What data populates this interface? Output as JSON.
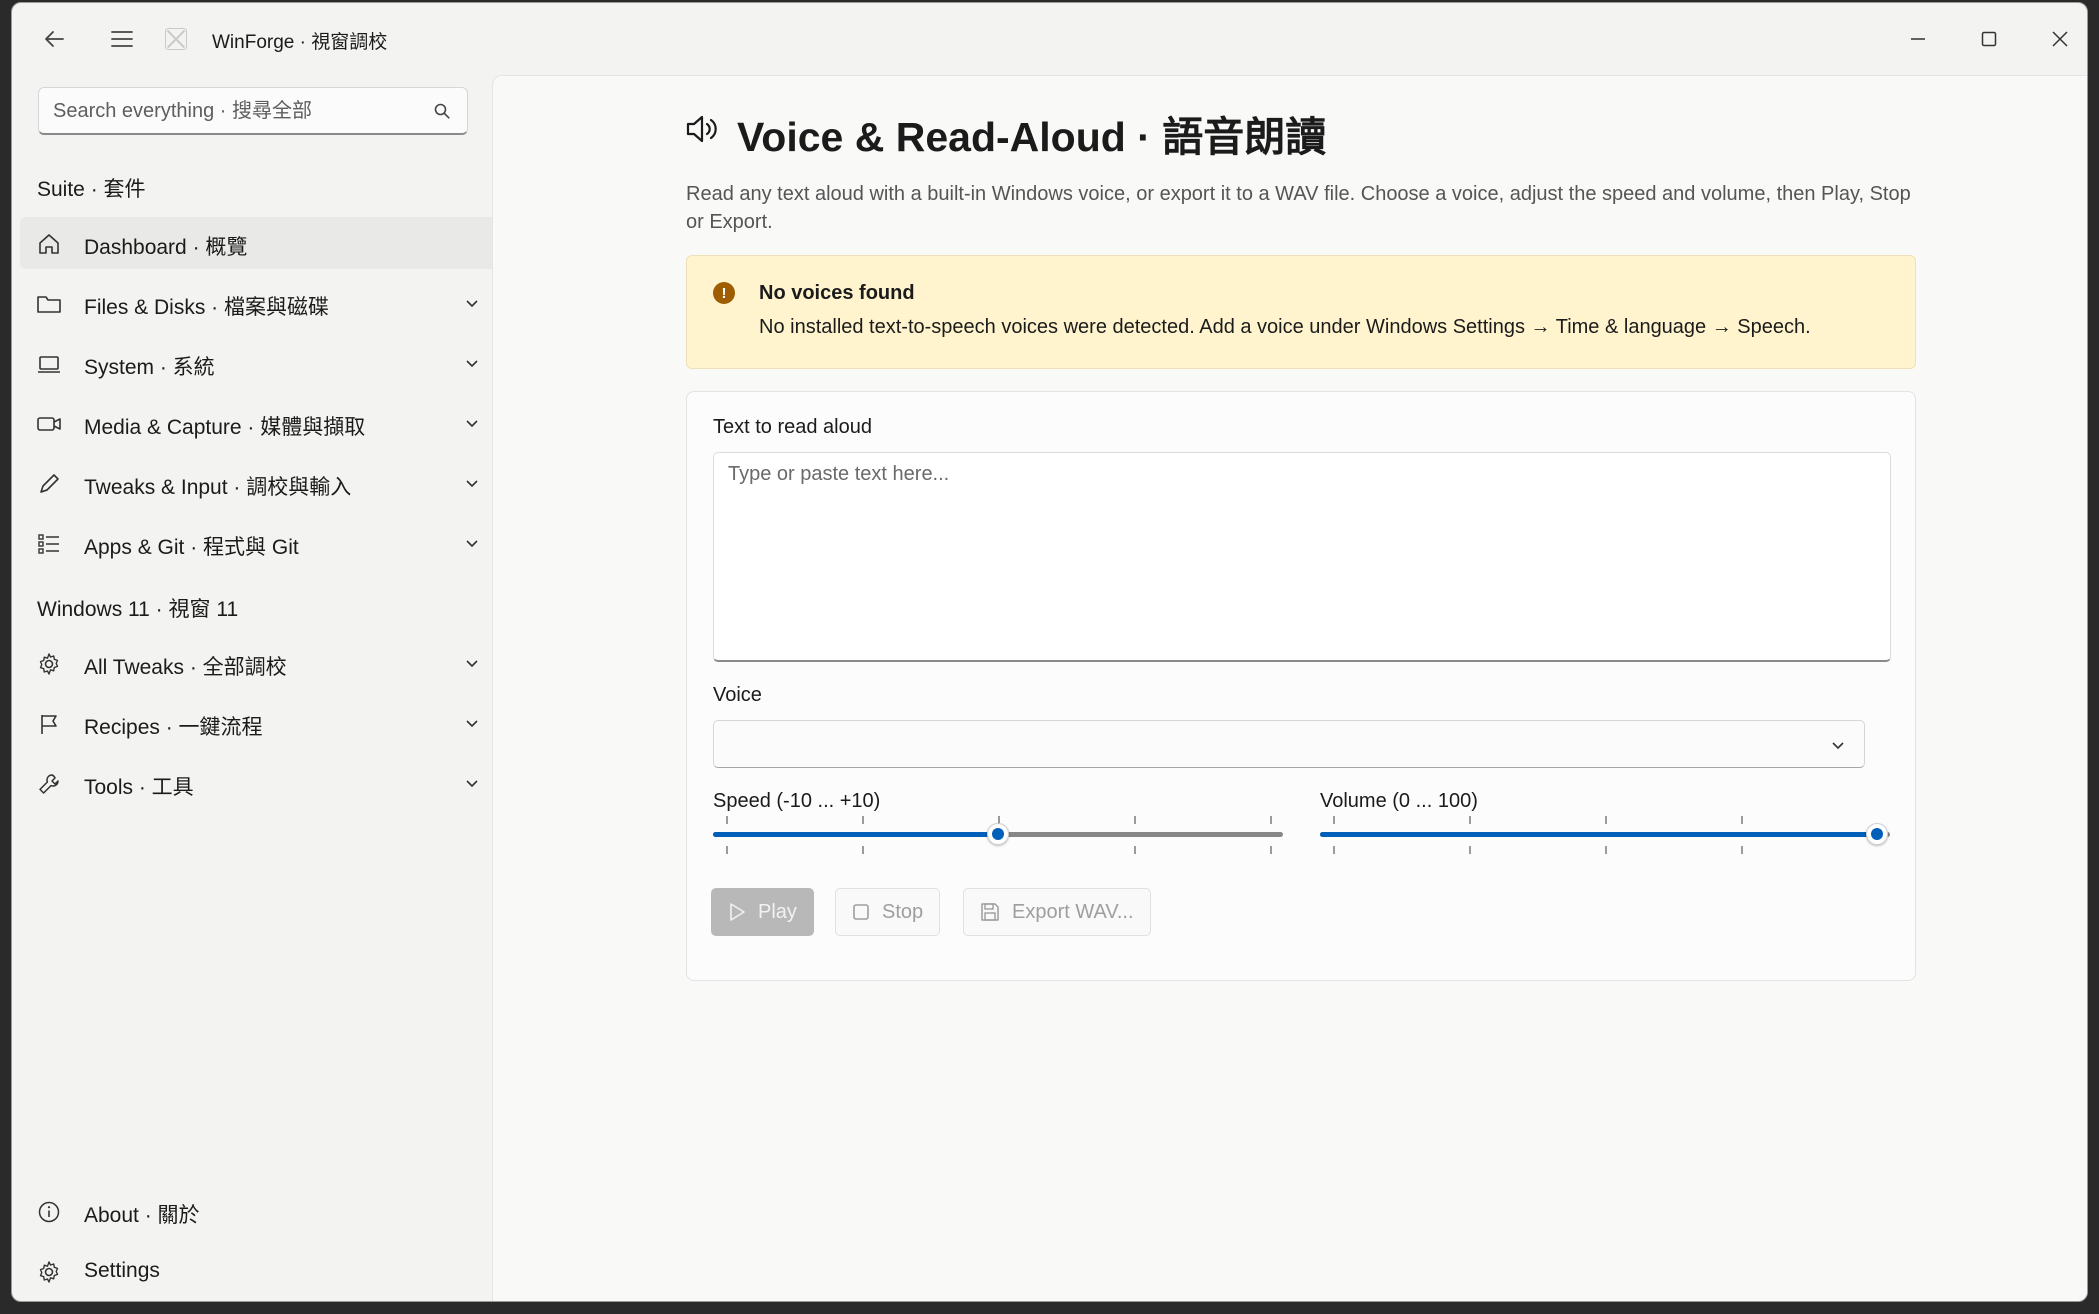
{
  "window": {
    "title": "WinForge · 視窗調校"
  },
  "sidebar": {
    "search_placeholder": "Search everything · 搜尋全部",
    "groups": [
      {
        "header": "Suite · 套件"
      },
      {
        "header": "Windows 11 · 視窗 11"
      }
    ],
    "items": [
      {
        "label": "Dashboard · 概覽",
        "icon": "home-icon",
        "selected": true,
        "expandable": false
      },
      {
        "label": "Files & Disks · 檔案與磁碟",
        "icon": "folder-icon",
        "expandable": true
      },
      {
        "label": "System · 系統",
        "icon": "laptop-icon",
        "expandable": true
      },
      {
        "label": "Media & Capture · 媒體與擷取",
        "icon": "video-camera-icon",
        "expandable": true
      },
      {
        "label": "Tweaks & Input · 調校與輸入",
        "icon": "pen-icon",
        "expandable": true
      },
      {
        "label": "Apps & Git · 程式與 Git",
        "icon": "list-icon",
        "expandable": true
      },
      {
        "label": "All Tweaks · 全部調校",
        "icon": "gear-icon",
        "expandable": true
      },
      {
        "label": "Recipes · 一鍵流程",
        "icon": "flag-icon",
        "expandable": true
      },
      {
        "label": "Tools · 工具",
        "icon": "wrench-icon",
        "expandable": true
      }
    ],
    "footer": [
      {
        "label": "About · 關於",
        "icon": "info-icon"
      },
      {
        "label": "Settings",
        "icon": "gear-icon"
      }
    ]
  },
  "page": {
    "title": "Voice & Read-Aloud · 語音朗讀",
    "description": "Read any text aloud with a built-in Windows voice, or export it to a WAV file. Choose a voice, adjust the speed and volume, then Play, Stop or Export.",
    "infobar": {
      "title": "No voices found",
      "message": "No installed text-to-speech voices were detected. Add a voice under Windows Settings → Time & language → Speech.",
      "severity": "warning"
    },
    "text_field": {
      "label": "Text to read aloud",
      "placeholder": "Type or paste text here...",
      "value": ""
    },
    "voice_field": {
      "label": "Voice",
      "value": ""
    },
    "speed": {
      "label": "Speed (-10 ... +10)",
      "min": -10,
      "max": 10,
      "value": 0
    },
    "volume": {
      "label": "Volume (0 ... 100)",
      "min": 0,
      "max": 100,
      "value": 100
    },
    "buttons": {
      "play": "Play",
      "stop": "Stop",
      "export": "Export WAV..."
    }
  },
  "colors": {
    "accent": "#005fb8",
    "warning_bg": "#fff4ce",
    "warning_icon": "#9d5d00"
  }
}
